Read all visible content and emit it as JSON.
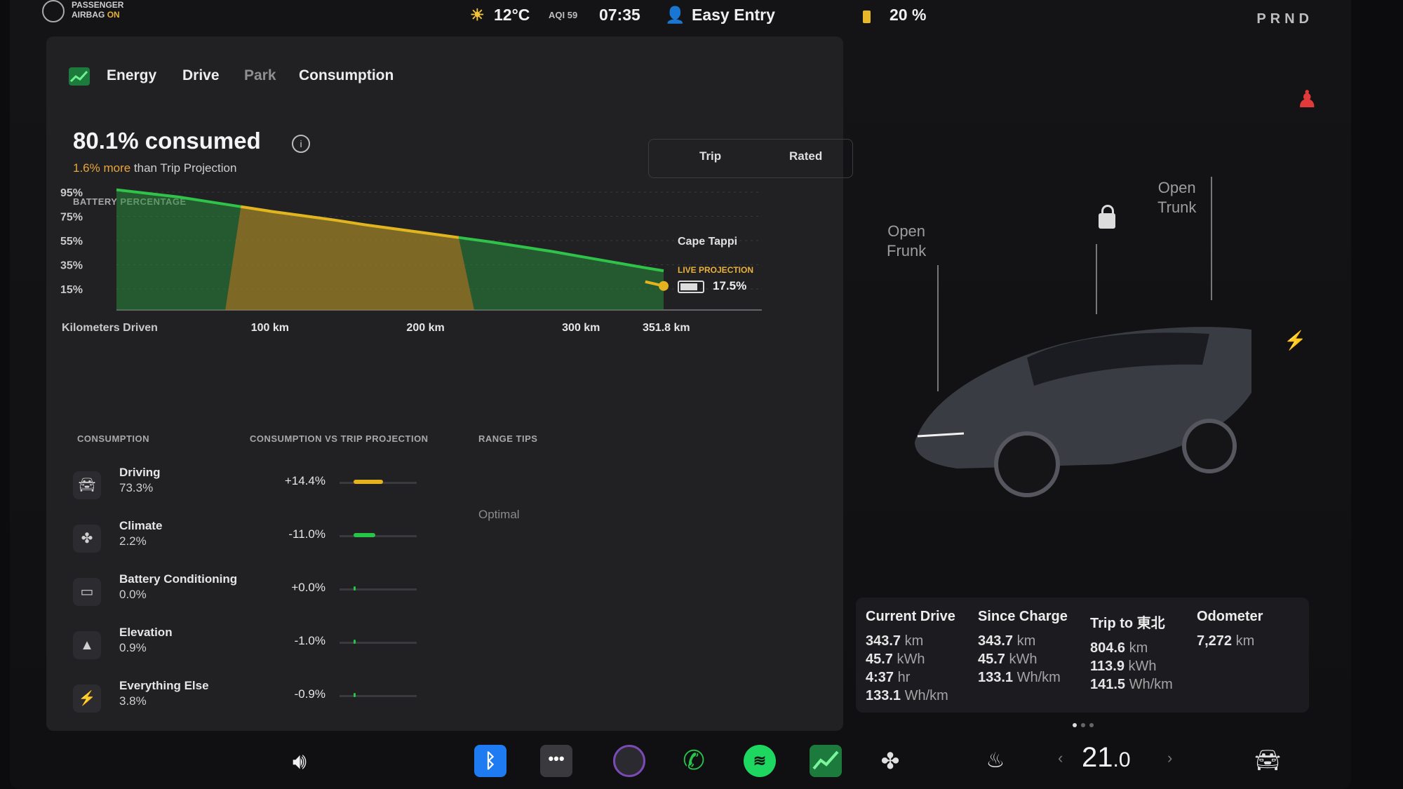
{
  "status": {
    "airbag_line1": "PASSENGER",
    "airbag_line2": "AIRBAG",
    "airbag_state": "ON",
    "temperature": "12°C",
    "aqi": "AQI 59",
    "time": "07:35",
    "profile": "Easy Entry",
    "battery": "20 %",
    "gear": "PRND"
  },
  "energy": {
    "tabs": [
      "Energy",
      "Drive",
      "Park",
      "Consumption"
    ],
    "headline": "80.1% consumed",
    "sub_highlight": "1.6% more",
    "sub_rest": " than Trip Projection",
    "battery_label": "BATTERY PERCENTAGE",
    "toggle": [
      "Trip",
      "Rated"
    ],
    "destination": "Cape Tappi",
    "live_projection_label": "LIVE PROJECTION",
    "live_projection_value": "17.5%"
  },
  "chart_data": {
    "type": "line",
    "ylabel": "BATTERY PERCENTAGE",
    "xlabel": "Kilometers Driven",
    "y_ticks": [
      "95%",
      "75%",
      "55%",
      "35%",
      "15%"
    ],
    "x_ticks": [
      "100 km",
      "200 km",
      "300 km",
      "351.8 km"
    ],
    "xlim": [
      0,
      351.8
    ],
    "ylim": [
      15,
      95
    ],
    "series": [
      {
        "x": [
          0,
          20,
          40,
          60,
          80,
          100,
          120,
          140,
          160,
          180,
          200,
          220,
          240,
          260,
          280,
          300,
          320,
          340,
          351.8
        ],
        "y": [
          97,
          94,
          91,
          87,
          83,
          79,
          75.5,
          72,
          68,
          64.5,
          61,
          57.5,
          54,
          50,
          46,
          41.5,
          37,
          32.5,
          30
        ]
      }
    ],
    "projection": {
      "x": [
        340,
        351.8
      ],
      "y": [
        21,
        17.5
      ]
    }
  },
  "consumption": {
    "headers": [
      "CONSUMPTION",
      "CONSUMPTION VS TRIP PROJECTION",
      "RANGE TIPS"
    ],
    "range_tip": "Optimal",
    "rows": [
      {
        "name": "Driving",
        "pct": "73.3%",
        "delta": "+14.4%",
        "icon": "car-icon",
        "bar": 0.3,
        "color": "#e5b31e"
      },
      {
        "name": "Climate",
        "pct": "2.2%",
        "delta": "-11.0%",
        "icon": "fan-icon",
        "bar": 0.22,
        "color": "#27c44a"
      },
      {
        "name": "Battery Conditioning",
        "pct": "0.0%",
        "delta": "+0.0%",
        "icon": "battery-icon",
        "bar": 0,
        "color": "#27c44a"
      },
      {
        "name": "Elevation",
        "pct": "0.9%",
        "delta": "-1.0%",
        "icon": "mountain-icon",
        "bar": 0.02,
        "color": "#27c44a"
      },
      {
        "name": "Everything Else",
        "pct": "3.8%",
        "delta": "-0.9%",
        "icon": "bolt-icon",
        "bar": 0.02,
        "color": "#27c44a"
      }
    ]
  },
  "car": {
    "open_frunk": [
      "Open",
      "Frunk"
    ],
    "open_trunk": [
      "Open",
      "Trunk"
    ]
  },
  "trips": [
    {
      "title": "Current Drive",
      "lines": [
        [
          "343.7",
          "km"
        ],
        [
          "45.7",
          "kWh"
        ],
        [
          "4:37",
          "hr"
        ],
        [
          "133.1",
          "Wh/km"
        ]
      ]
    },
    {
      "title": "Since Charge",
      "lines": [
        [
          "343.7",
          "km"
        ],
        [
          "45.7",
          "kWh"
        ],
        [
          "133.1",
          "Wh/km"
        ]
      ]
    },
    {
      "title": "Trip to 東北",
      "lines": [
        [
          "804.6",
          "km"
        ],
        [
          "113.9",
          "kWh"
        ],
        [
          "141.5",
          "Wh/km"
        ]
      ]
    },
    {
      "title": "Odometer",
      "lines": [
        [
          "7,272",
          "km"
        ]
      ]
    }
  ],
  "dock": {
    "temperature_whole": "21",
    "temperature_dec": ".0"
  }
}
